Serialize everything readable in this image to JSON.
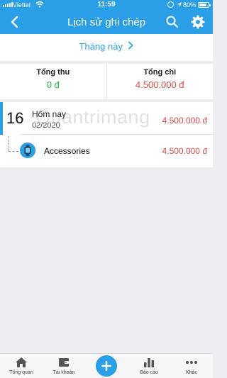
{
  "status_bar": {
    "carrier": "Viettel",
    "time": "11:59",
    "battery": "80%",
    "battery_level": 0.8
  },
  "nav": {
    "title": "Lịch sử ghi chép",
    "back_icon": "chevron-left-icon",
    "search_icon": "search-icon",
    "settings_icon": "gear-icon"
  },
  "period": {
    "label": "Tháng này"
  },
  "totals": {
    "income_label": "Tổng thu",
    "income_value": "0 đ",
    "expense_label": "Tổng chi",
    "expense_value": "4.500.000 đ"
  },
  "day_group": {
    "day": "16",
    "day_name": "Hôm nay",
    "month_year": "02/2020",
    "total": "4.500.000 đ",
    "entries": [
      {
        "category": "Accessories",
        "amount": "4.500.000 đ",
        "icon": "watch-icon"
      }
    ]
  },
  "watermark": {
    "text": "Quantrimang"
  },
  "tabs": [
    {
      "label": "Tổng quan",
      "icon": "home-icon"
    },
    {
      "label": "Tài khoản",
      "icon": "wallet-icon"
    },
    {
      "label": "",
      "icon": "plus-icon"
    },
    {
      "label": "Báo cáo",
      "icon": "bar-chart-icon"
    },
    {
      "label": "Khác",
      "icon": "more-icon"
    }
  ],
  "colors": {
    "accent": "#2a9fe8",
    "income": "#1fbf3a",
    "expense": "#e04b4b",
    "background": "#ededf1"
  }
}
